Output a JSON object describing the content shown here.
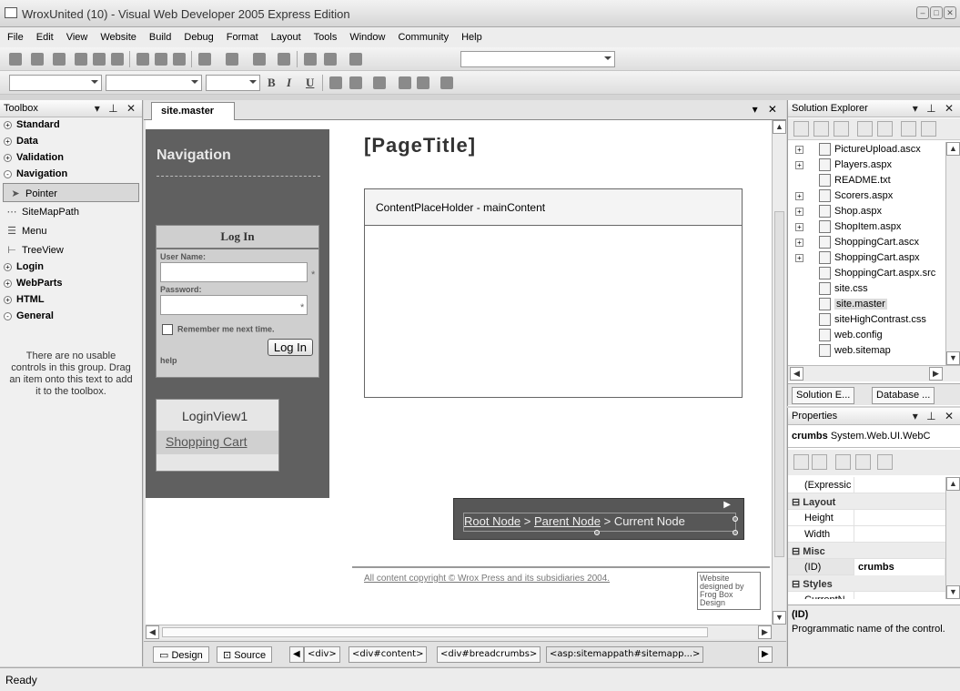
{
  "window": {
    "title": "WroxUnited (10) - Visual Web Developer 2005 Express Edition"
  },
  "menu": [
    "File",
    "Edit",
    "View",
    "Website",
    "Build",
    "Debug",
    "Format",
    "Layout",
    "Tools",
    "Window",
    "Community",
    "Help"
  ],
  "format_toolbar": {
    "bold": "B",
    "italic": "I",
    "underline": "U"
  },
  "toolbox": {
    "title": "Toolbox",
    "categories": [
      {
        "label": "Standard",
        "state": "+"
      },
      {
        "label": "Data",
        "state": "+"
      },
      {
        "label": "Validation",
        "state": "+"
      },
      {
        "label": "Navigation",
        "state": "-"
      }
    ],
    "items": [
      {
        "label": "Pointer",
        "icon": "pointer-icon",
        "glyph": "➤"
      },
      {
        "label": "SiteMapPath",
        "icon": "sitemappath-icon",
        "glyph": "⋯"
      },
      {
        "label": "Menu",
        "icon": "menu-icon",
        "glyph": "☰"
      },
      {
        "label": "TreeView",
        "icon": "treeview-icon",
        "glyph": "⊢"
      }
    ],
    "categories2": [
      {
        "label": "Login",
        "state": "+"
      },
      {
        "label": "WebParts",
        "state": "+"
      },
      {
        "label": "HTML",
        "state": "+"
      },
      {
        "label": "General",
        "state": "-"
      }
    ],
    "empty_message": "There are no usable controls in this group. Drag an item onto this text to add it to the toolbox."
  },
  "editor": {
    "tab": "site.master",
    "nav_title": "Navigation",
    "login": {
      "title": "Log In",
      "user_label": "User Name:",
      "password_label": "Password:",
      "remember": "Remember me next time.",
      "button": "Log In",
      "help": "help",
      "required": "*"
    },
    "loginview": {
      "title": "LoginView1",
      "link": "Shopping Cart"
    },
    "page_title": "[PageTitle]",
    "placeholder": "ContentPlaceHolder - mainContent",
    "crumbs": {
      "root": "Root Node",
      "parent": "Parent Node",
      "current": "Current Node",
      "sep": " > "
    },
    "copyright": "All content copyright © Wrox Press and its subsidiaries 2004.",
    "designed_by": "Website designed by Frog Box Design",
    "views": {
      "design": "Design",
      "source": "Source"
    },
    "tags": [
      "<div>",
      "<div#content>",
      "<div#breadcrumbs>",
      "<asp:sitemappath#sitemapp...>"
    ]
  },
  "solution_explorer": {
    "title": "Solution Explorer",
    "files": [
      {
        "name": "PictureUpload.ascx",
        "expand": true
      },
      {
        "name": "Players.aspx",
        "expand": true
      },
      {
        "name": "README.txt",
        "expand": false
      },
      {
        "name": "Scorers.aspx",
        "expand": true
      },
      {
        "name": "Shop.aspx",
        "expand": true
      },
      {
        "name": "ShopItem.aspx",
        "expand": true
      },
      {
        "name": "ShoppingCart.ascx",
        "expand": true
      },
      {
        "name": "ShoppingCart.aspx",
        "expand": true
      },
      {
        "name": "ShoppingCart.aspx.src",
        "expand": false
      },
      {
        "name": "site.css",
        "expand": false
      },
      {
        "name": "site.master",
        "expand": false
      },
      {
        "name": "siteHighContrast.css",
        "expand": false
      },
      {
        "name": "web.config",
        "expand": false
      },
      {
        "name": "web.sitemap",
        "expand": false
      }
    ],
    "tabs": [
      "Solution E...",
      "Database ..."
    ]
  },
  "properties": {
    "title": "Properties",
    "object_name": "crumbs",
    "object_type": "System.Web.UI.WebC",
    "rows": [
      {
        "type": "prop",
        "key": "(Expressic",
        "value": ""
      },
      {
        "type": "cat",
        "key": "Layout"
      },
      {
        "type": "prop",
        "key": "Height",
        "value": ""
      },
      {
        "type": "prop",
        "key": "Width",
        "value": ""
      },
      {
        "type": "cat",
        "key": "Misc"
      },
      {
        "type": "prop",
        "key": "(ID)",
        "value": "crumbs"
      },
      {
        "type": "cat",
        "key": "Styles"
      },
      {
        "type": "prop",
        "key": "CurrentN",
        "value": ""
      }
    ],
    "desc_title": "(ID)",
    "desc_text": "Programmatic name of the control."
  },
  "status": "Ready"
}
